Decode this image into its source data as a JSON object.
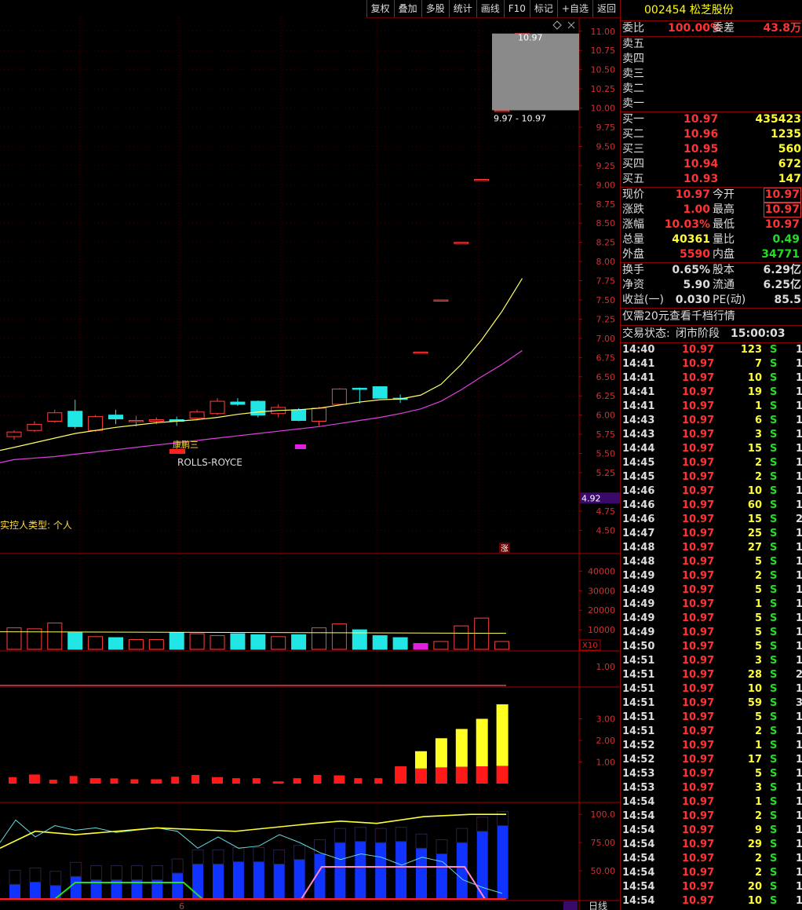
{
  "toolbar": {
    "items": [
      "复权",
      "叠加",
      "多股",
      "统计",
      "画线",
      "F10",
      "标记",
      "+自选",
      "返回"
    ]
  },
  "stock": {
    "code": "002454",
    "name": "松芝股份"
  },
  "commission": {
    "ratio_label": "委比",
    "ratio": "100.00%",
    "diff_label": "委差",
    "diff": "43.8万"
  },
  "asks": [
    {
      "label": "卖五",
      "price": "",
      "vol": ""
    },
    {
      "label": "卖四",
      "price": "",
      "vol": ""
    },
    {
      "label": "卖三",
      "price": "",
      "vol": ""
    },
    {
      "label": "卖二",
      "price": "",
      "vol": ""
    },
    {
      "label": "卖一",
      "price": "",
      "vol": ""
    }
  ],
  "bids": [
    {
      "label": "买一",
      "price": "10.97",
      "vol": "435423"
    },
    {
      "label": "买二",
      "price": "10.96",
      "vol": "1235"
    },
    {
      "label": "买三",
      "price": "10.95",
      "vol": "560"
    },
    {
      "label": "买四",
      "price": "10.94",
      "vol": "672"
    },
    {
      "label": "买五",
      "price": "10.93",
      "vol": "147"
    }
  ],
  "quote": [
    {
      "l1": "现价",
      "v1": "10.97",
      "c1": "red",
      "l2": "今开",
      "v2": "10.97",
      "c2": "red",
      "box": true
    },
    {
      "l1": "涨跌",
      "v1": "1.00",
      "c1": "red",
      "l2": "最高",
      "v2": "10.97",
      "c2": "red",
      "box": true
    },
    {
      "l1": "涨幅",
      "v1": "10.03%",
      "c1": "red",
      "l2": "最低",
      "v2": "10.97",
      "c2": "red",
      "box": false
    },
    {
      "l1": "总量",
      "v1": "40361",
      "c1": "yel",
      "l2": "量比",
      "v2": "0.49",
      "c2": "grn",
      "box": false
    },
    {
      "l1": "外盘",
      "v1": "5590",
      "c1": "red",
      "l2": "内盘",
      "v2": "34771",
      "c2": "grn",
      "box": false
    }
  ],
  "fundamentals": [
    {
      "l1": "换手",
      "v1": "0.65%",
      "l2": "股本",
      "v2": "6.29亿"
    },
    {
      "l1": "净资",
      "v1": "5.90",
      "l2": "流通",
      "v2": "6.25亿"
    },
    {
      "l1": "收益(一)",
      "v1": "0.030",
      "l2": "PE(动)",
      "v2": "85.5"
    }
  ],
  "promo": "仅需20元查看千档行情",
  "trade_status": {
    "label": "交易状态:",
    "value": "闭市阶段",
    "time": "15:00:03"
  },
  "ticks": [
    [
      "14:40",
      "10.97",
      "123",
      "S",
      "1"
    ],
    [
      "14:41",
      "10.97",
      "7",
      "S",
      "1"
    ],
    [
      "14:41",
      "10.97",
      "10",
      "S",
      "1"
    ],
    [
      "14:41",
      "10.97",
      "19",
      "S",
      "1"
    ],
    [
      "14:41",
      "10.97",
      "1",
      "S",
      "1"
    ],
    [
      "14:43",
      "10.97",
      "6",
      "S",
      "1"
    ],
    [
      "14:43",
      "10.97",
      "3",
      "S",
      "1"
    ],
    [
      "14:44",
      "10.97",
      "15",
      "S",
      "1"
    ],
    [
      "14:45",
      "10.97",
      "2",
      "S",
      "1"
    ],
    [
      "14:45",
      "10.97",
      "2",
      "S",
      "1"
    ],
    [
      "14:46",
      "10.97",
      "10",
      "S",
      "1"
    ],
    [
      "14:46",
      "10.97",
      "60",
      "S",
      "1"
    ],
    [
      "14:46",
      "10.97",
      "15",
      "S",
      "2"
    ],
    [
      "14:47",
      "10.97",
      "25",
      "S",
      "1"
    ],
    [
      "14:48",
      "10.97",
      "27",
      "S",
      "1"
    ],
    [
      "14:48",
      "10.97",
      "5",
      "S",
      "1"
    ],
    [
      "14:49",
      "10.97",
      "2",
      "S",
      "1"
    ],
    [
      "14:49",
      "10.97",
      "5",
      "S",
      "1"
    ],
    [
      "14:49",
      "10.97",
      "1",
      "S",
      "1"
    ],
    [
      "14:49",
      "10.97",
      "5",
      "S",
      "1"
    ],
    [
      "14:49",
      "10.97",
      "5",
      "S",
      "1"
    ],
    [
      "14:50",
      "10.97",
      "5",
      "S",
      "1"
    ],
    [
      "14:51",
      "10.97",
      "3",
      "S",
      "1"
    ],
    [
      "14:51",
      "10.97",
      "28",
      "S",
      "2"
    ],
    [
      "14:51",
      "10.97",
      "10",
      "S",
      "1"
    ],
    [
      "14:51",
      "10.97",
      "59",
      "S",
      "3"
    ],
    [
      "14:51",
      "10.97",
      "5",
      "S",
      "1"
    ],
    [
      "14:51",
      "10.97",
      "2",
      "S",
      "1"
    ],
    [
      "14:52",
      "10.97",
      "1",
      "S",
      "1"
    ],
    [
      "14:52",
      "10.97",
      "17",
      "S",
      "1"
    ],
    [
      "14:53",
      "10.97",
      "5",
      "S",
      "1"
    ],
    [
      "14:53",
      "10.97",
      "3",
      "S",
      "1"
    ],
    [
      "14:54",
      "10.97",
      "1",
      "S",
      "1"
    ],
    [
      "14:54",
      "10.97",
      "2",
      "S",
      "1"
    ],
    [
      "14:54",
      "10.97",
      "9",
      "S",
      "1"
    ],
    [
      "14:54",
      "10.97",
      "29",
      "S",
      "1"
    ],
    [
      "14:54",
      "10.97",
      "2",
      "S",
      "1"
    ],
    [
      "14:54",
      "10.97",
      "2",
      "S",
      "1"
    ],
    [
      "14:54",
      "10.97",
      "20",
      "S",
      "1"
    ],
    [
      "14:54",
      "10.97",
      "10",
      "S",
      "1"
    ]
  ],
  "chart_data": {
    "type": "candlestick",
    "price_axis": {
      "range": [
        4.35,
        11.1
      ],
      "ticks": [
        "11.00",
        "10.75",
        "10.50",
        "10.25",
        "10.00",
        "9.75",
        "9.50",
        "9.25",
        "9.00",
        "8.75",
        "8.50",
        "8.25",
        "8.00",
        "7.75",
        "7.50",
        "7.25",
        "7.00",
        "6.75",
        "6.50",
        "6.25",
        "6.00",
        "5.75",
        "5.50",
        "5.25",
        "4.75",
        "4.50"
      ],
      "current_marker": "4.92"
    },
    "candles": [
      {
        "o": 5.72,
        "h": 5.8,
        "l": 5.68,
        "c": 5.78
      },
      {
        "o": 5.8,
        "h": 5.92,
        "l": 5.78,
        "c": 5.88
      },
      {
        "o": 5.92,
        "h": 6.07,
        "l": 5.9,
        "c": 6.03
      },
      {
        "o": 6.05,
        "h": 6.2,
        "l": 5.82,
        "c": 5.85
      },
      {
        "o": 5.8,
        "h": 6.0,
        "l": 5.78,
        "c": 5.98
      },
      {
        "o": 6.0,
        "h": 6.07,
        "l": 5.88,
        "c": 5.95
      },
      {
        "o": 5.93,
        "h": 5.99,
        "l": 5.85,
        "c": 5.93
      },
      {
        "o": 5.92,
        "h": 5.97,
        "l": 5.88,
        "c": 5.94
      },
      {
        "o": 5.94,
        "h": 5.98,
        "l": 5.86,
        "c": 5.92
      },
      {
        "o": 5.96,
        "h": 6.07,
        "l": 5.93,
        "c": 6.04
      },
      {
        "o": 6.02,
        "h": 6.22,
        "l": 6.0,
        "c": 6.18
      },
      {
        "o": 6.17,
        "h": 6.22,
        "l": 6.12,
        "c": 6.14
      },
      {
        "o": 6.18,
        "h": 6.19,
        "l": 5.97,
        "c": 6.0
      },
      {
        "o": 6.02,
        "h": 6.14,
        "l": 5.97,
        "c": 6.1
      },
      {
        "o": 6.07,
        "h": 6.09,
        "l": 5.92,
        "c": 5.93
      },
      {
        "o": 5.92,
        "h": 6.11,
        "l": 5.86,
        "c": 6.09
      },
      {
        "o": 6.14,
        "h": 6.35,
        "l": 6.13,
        "c": 6.34
      },
      {
        "o": 6.35,
        "h": 6.36,
        "l": 6.15,
        "c": 6.34
      },
      {
        "o": 6.37,
        "h": 6.37,
        "l": 6.22,
        "c": 6.22
      },
      {
        "o": 6.22,
        "h": 6.27,
        "l": 6.16,
        "c": 6.21
      },
      {
        "o": 6.82,
        "h": 6.82,
        "l": 6.82,
        "c": 6.82
      },
      {
        "o": 7.5,
        "h": 7.5,
        "l": 7.5,
        "c": 7.5
      },
      {
        "o": 8.25,
        "h": 8.25,
        "l": 8.25,
        "c": 8.25
      },
      {
        "o": 9.07,
        "h": 9.07,
        "l": 9.07,
        "c": 9.07
      },
      {
        "o": 9.97,
        "h": 9.97,
        "l": 9.97,
        "c": 9.97
      },
      {
        "o": 10.97,
        "h": 10.97,
        "l": 10.97,
        "c": 10.97
      }
    ],
    "ma_fast": [
      5.58,
      5.64,
      5.7,
      5.76,
      5.8,
      5.84,
      5.87,
      5.9,
      5.92,
      5.94,
      5.97,
      6.01,
      6.04,
      6.06,
      6.07,
      6.09,
      6.13,
      6.17,
      6.2,
      6.21,
      6.26,
      6.4,
      6.66,
      6.98,
      7.35,
      7.78
    ],
    "ma_slow": [
      5.42,
      5.44,
      5.46,
      5.49,
      5.52,
      5.55,
      5.58,
      5.61,
      5.64,
      5.67,
      5.7,
      5.73,
      5.76,
      5.79,
      5.82,
      5.85,
      5.89,
      5.93,
      5.97,
      6.02,
      6.08,
      6.18,
      6.33,
      6.5,
      6.66,
      6.84
    ],
    "range_label": "9.97 - 10.97",
    "peak_label": "10.97",
    "annotation_mark": "康鹏三",
    "annotation_text": "ROLLS-ROYCE",
    "holder_note": "实控人类型: 个人",
    "limit_badge": "涨",
    "volume": {
      "ticks": [
        "40000",
        "30000",
        "20000",
        "10000"
      ],
      "unit": "X10",
      "values": [
        11000,
        10500,
        13500,
        8500,
        6500,
        6000,
        5000,
        5000,
        8500,
        8000,
        7000,
        8000,
        7500,
        6500,
        7500,
        11000,
        13000,
        10000,
        7000,
        6000,
        3000,
        4000,
        12000,
        16000,
        4000
      ],
      "ma": 9000
    },
    "panel3": {
      "ticks": [
        "1.00"
      ]
    },
    "macd": {
      "ticks": [
        "3.00",
        "2.00",
        "1.00"
      ],
      "red": [
        0.3,
        0.42,
        0.18,
        0.35,
        0.25,
        0.24,
        0.2,
        0.2,
        0.32,
        0.4,
        0.3,
        0.25,
        0.25,
        0.1,
        0.25,
        0.4,
        0.38,
        0.25,
        0.25,
        0.8,
        0.7,
        0.75,
        0.78,
        0.8,
        0.82
      ],
      "yellow": [
        0,
        0,
        0,
        0,
        0,
        0,
        0,
        0,
        0,
        0,
        0,
        0,
        0,
        0,
        0,
        0,
        0,
        0,
        0,
        0,
        0.8,
        1.35,
        1.75,
        2.2,
        2.85
      ]
    },
    "kdj": {
      "ticks": [
        "100.0",
        "75.00",
        "50.00"
      ],
      "bar_label": "日线",
      "date_label": "6"
    }
  }
}
